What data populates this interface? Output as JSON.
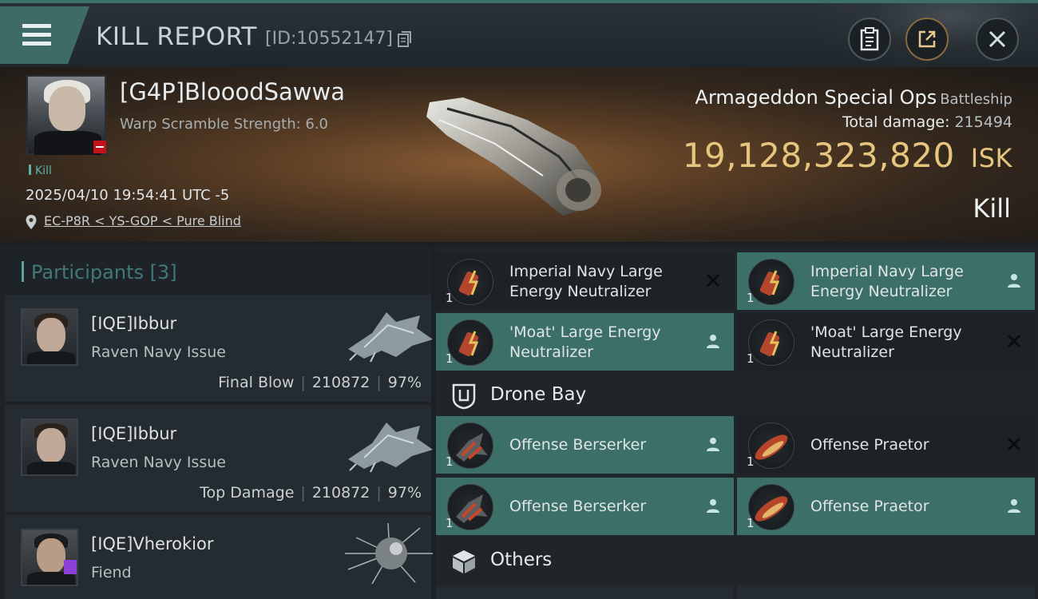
{
  "header": {
    "title": "KILL REPORT",
    "report_id": "[ID:10552147]"
  },
  "victim": {
    "name": "[G4P]BlooodSawwa",
    "warp_scramble": "Warp Scramble Strength: 6.0",
    "kill_tag": "Kill",
    "datetime": "2025/04/10 19:54:41 UTC -5",
    "location": "EC-P8R < YS-GOP < Pure Blind",
    "ship_name": "Armageddon Special Ops",
    "ship_class": "Battleship",
    "total_damage_label": "Total damage:",
    "total_damage": "215494",
    "isk_value": "19,128,323,820",
    "isk_unit": "ISK",
    "result": "Kill"
  },
  "participants": {
    "label": "Participants",
    "count": "[3]",
    "rows": [
      {
        "name": "[IQE]Ibbur",
        "ship": "Raven Navy Issue",
        "role": "Final Blow",
        "damage": "210872",
        "percent": "97%"
      },
      {
        "name": "[IQE]Ibbur",
        "ship": "Raven Navy Issue",
        "role": "Top Damage",
        "damage": "210872",
        "percent": "97%"
      },
      {
        "name": "[IQE]Vherokior",
        "ship": "Fiend",
        "role": "",
        "damage": "",
        "percent": ""
      }
    ]
  },
  "items": [
    {
      "name": "Imperial Navy Large Energy Neutralizer",
      "qty": "1",
      "status": "destroyed",
      "highlight": false
    },
    {
      "name": "Imperial Navy Large Energy Neutralizer",
      "qty": "1",
      "status": "dropped",
      "highlight": true
    },
    {
      "name": "'Moat' Large Energy Neutralizer",
      "qty": "1",
      "status": "dropped",
      "highlight": true
    },
    {
      "name": "'Moat' Large Energy Neutralizer",
      "qty": "1",
      "status": "destroyed",
      "highlight": false
    }
  ],
  "drone_bay": {
    "title": "Drone Bay",
    "items": [
      {
        "name": "Offense  Berserker",
        "qty": "1",
        "status": "dropped",
        "highlight": true
      },
      {
        "name": "Offense  Praetor",
        "qty": "1",
        "status": "destroyed",
        "highlight": false
      },
      {
        "name": "Offense  Berserker",
        "qty": "1",
        "status": "dropped",
        "highlight": true
      },
      {
        "name": "Offense  Praetor",
        "qty": "1",
        "status": "dropped",
        "highlight": true
      }
    ]
  },
  "others": {
    "title": "Others"
  },
  "icons": {
    "menu": "hamburger-icon",
    "copy": "copy-icon",
    "clipboard": "clipboard-icon",
    "share": "share-icon",
    "close": "close-icon",
    "pin": "location-pin-icon",
    "drone_bay": "drone-bay-icon",
    "others": "cube-icon",
    "dropped": "person-icon",
    "destroyed": "x-icon"
  },
  "colors": {
    "accent": "#3d6f69",
    "isk": "#e6c57e",
    "victim_badge": "#c4121b",
    "teal_text": "#43787a"
  }
}
